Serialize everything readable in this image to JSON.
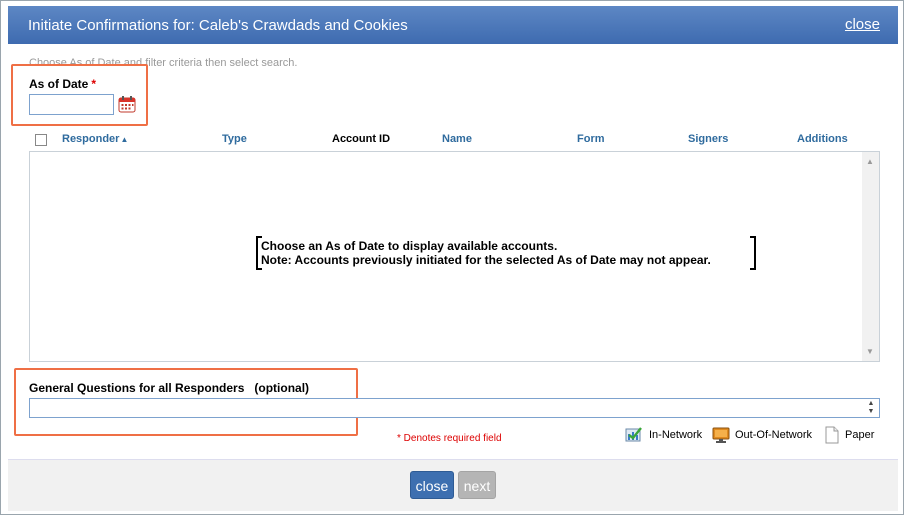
{
  "dialog": {
    "title": "Initiate Confirmations for: Caleb's Crawdads and Cookies",
    "close_link": "close"
  },
  "instruction": "Choose As of Date and filter criteria then select search.",
  "as_of_date": {
    "label": "As of Date",
    "required_mark": "*",
    "value": ""
  },
  "table": {
    "columns": [
      "Responder",
      "Type",
      "Account ID",
      "Name",
      "Form",
      "Signers",
      "Additions"
    ],
    "sort_indicator": "▲",
    "empty_message_line1": "Choose an As of Date to display available accounts.",
    "empty_message_line2": "Note: Accounts previously initiated for the selected As of Date may not appear."
  },
  "general_questions": {
    "label": "General Questions for all Responders   (optional)",
    "value": ""
  },
  "required_note": "* Denotes required field",
  "legend": {
    "in_network": "In-Network",
    "out_of_network": "Out-Of-Network",
    "paper": "Paper"
  },
  "footer": {
    "close_button": "close",
    "next_button": "next"
  },
  "colors": {
    "title_bar": "#4a78bb",
    "highlight": "#ef6f45",
    "link": "#2f6b9e",
    "required": "#dd0000"
  }
}
